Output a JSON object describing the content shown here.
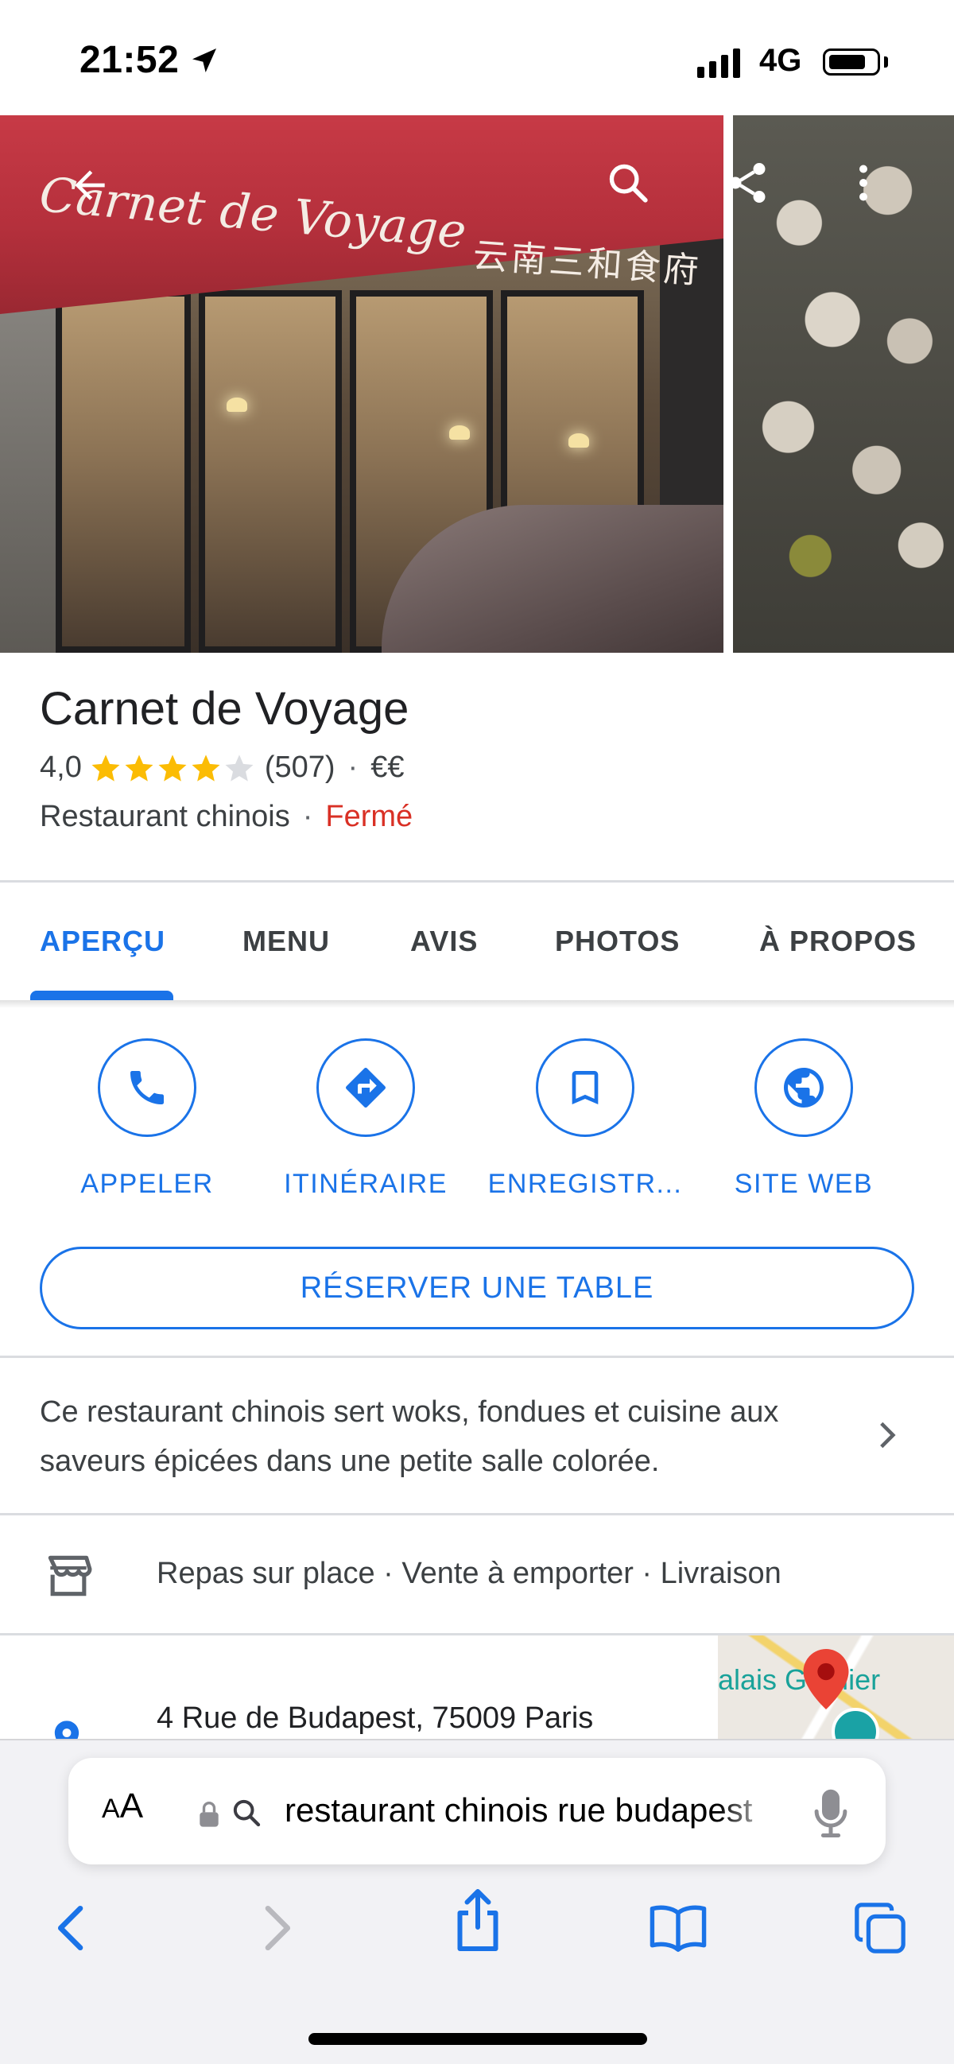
{
  "status_bar": {
    "time": "21:52",
    "network": "4G",
    "battery_level": 0.8
  },
  "photos": {
    "awning_text_latin": "Carnet de Voyage",
    "awning_text_cjk": "云南三和食府"
  },
  "place": {
    "name": "Carnet de Voyage",
    "rating": "4,0",
    "rating_value": 4.0,
    "review_count": "(507)",
    "price": "€€",
    "category": "Restaurant chinois",
    "status": "Fermé",
    "separator": "·"
  },
  "tabs": [
    {
      "label": "APERÇU",
      "active": true
    },
    {
      "label": "MENU",
      "active": false
    },
    {
      "label": "AVIS",
      "active": false
    },
    {
      "label": "PHOTOS",
      "active": false
    },
    {
      "label": "À PROPOS",
      "active": false
    }
  ],
  "actions": [
    {
      "label": "APPELER",
      "icon": "phone-icon"
    },
    {
      "label": "ITINÉRAIRE",
      "icon": "directions-icon"
    },
    {
      "label": "ENREGISTR...",
      "icon": "bookmark-icon"
    },
    {
      "label": "SITE WEB",
      "icon": "globe-icon"
    }
  ],
  "reserve_label": "RÉSERVER UNE TABLE",
  "description": "Ce restaurant chinois sert woks, fondues et cuisine aux saveurs épicées dans une petite salle colorée.",
  "services": "Repas sur place · Vente à emporter · Livraison",
  "address": "4 Rue de Budapest, 75009 Paris",
  "map_label": "alais Garnier",
  "safari": {
    "aa_label_small": "A",
    "aa_label_large": "A",
    "url": "restaurant chinois rue budapest"
  },
  "colors": {
    "accent": "#1a73e8",
    "closed": "#d93025",
    "star": "#fbbc04",
    "star_empty": "#dadce0"
  }
}
